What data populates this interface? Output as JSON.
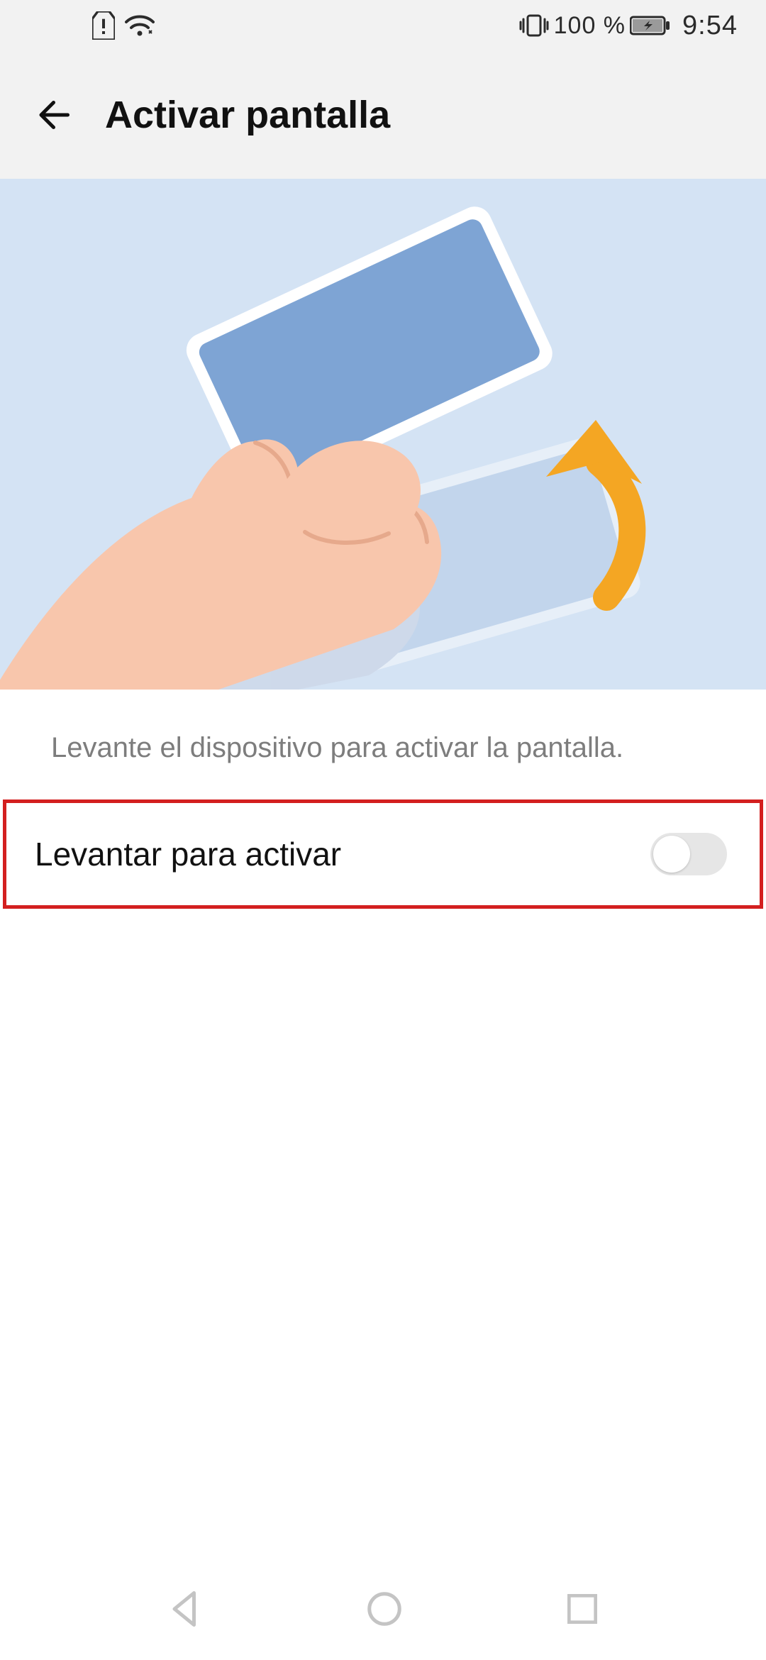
{
  "status": {
    "battery_text": "100 %",
    "time": "9:54"
  },
  "header": {
    "title": "Activar pantalla"
  },
  "description": "Levante el dispositivo para activar la pantalla.",
  "setting": {
    "label": "Levantar para activar",
    "enabled": false
  }
}
